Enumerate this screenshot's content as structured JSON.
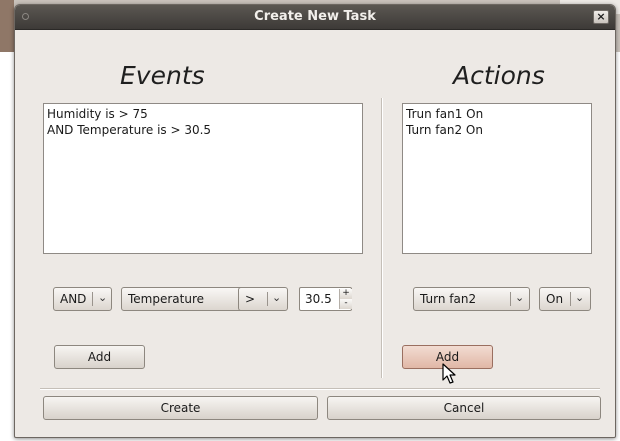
{
  "window": {
    "title": "Create New Task",
    "close_glyph": "×"
  },
  "events": {
    "heading": "Events",
    "lines": [
      "Humidity is > 75",
      "AND Temperature is > 30.5"
    ],
    "logic_select": "AND",
    "field_select": "Temperature",
    "operator_select": ">",
    "value_spin": "30.5",
    "spin_up": "+",
    "spin_down": "-",
    "add_label": "Add"
  },
  "actions": {
    "heading": "Actions",
    "lines": [
      "Trun fan1 On",
      "Turn fan2 On"
    ],
    "device_select": "Turn fan2",
    "state_select": "On",
    "add_label": "Add"
  },
  "footer": {
    "create_label": "Create",
    "cancel_label": "Cancel"
  },
  "icons": {
    "dropdown": "chevron-down-icon",
    "cursor": "mouse-pointer-icon"
  }
}
